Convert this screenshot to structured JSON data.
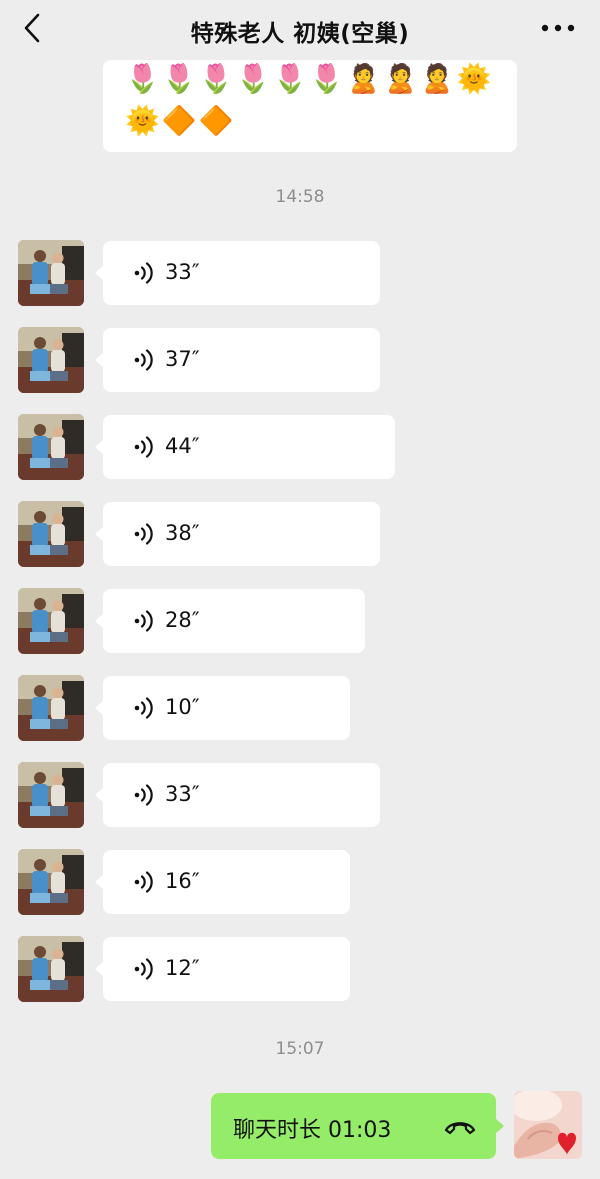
{
  "header": {
    "title": "特殊老人  初姨(空巢)",
    "back_icon": "chevron-left-icon",
    "more_icon": "more-dots-icon"
  },
  "top_message": {
    "line1": "🌷🌷🌷🌷🌷🌷🙎🙎🙎🌞",
    "line2": "🌞🔶🔶"
  },
  "timestamps": [
    "14:58",
    "15:07"
  ],
  "voice_messages": [
    {
      "duration": "33″"
    },
    {
      "duration": "37″"
    },
    {
      "duration": "44″"
    },
    {
      "duration": "38″"
    },
    {
      "duration": "28″"
    },
    {
      "duration": "10″"
    },
    {
      "duration": "33″"
    },
    {
      "duration": "16″"
    },
    {
      "duration": "12″"
    }
  ],
  "call_message": {
    "text": "聊天时长 01:03",
    "icon": "phone-hangup-icon"
  },
  "colors": {
    "background": "#ededed",
    "bubble_incoming": "#ffffff",
    "bubble_outgoing": "#95ec69",
    "timestamp_text": "#8d8d8d"
  }
}
